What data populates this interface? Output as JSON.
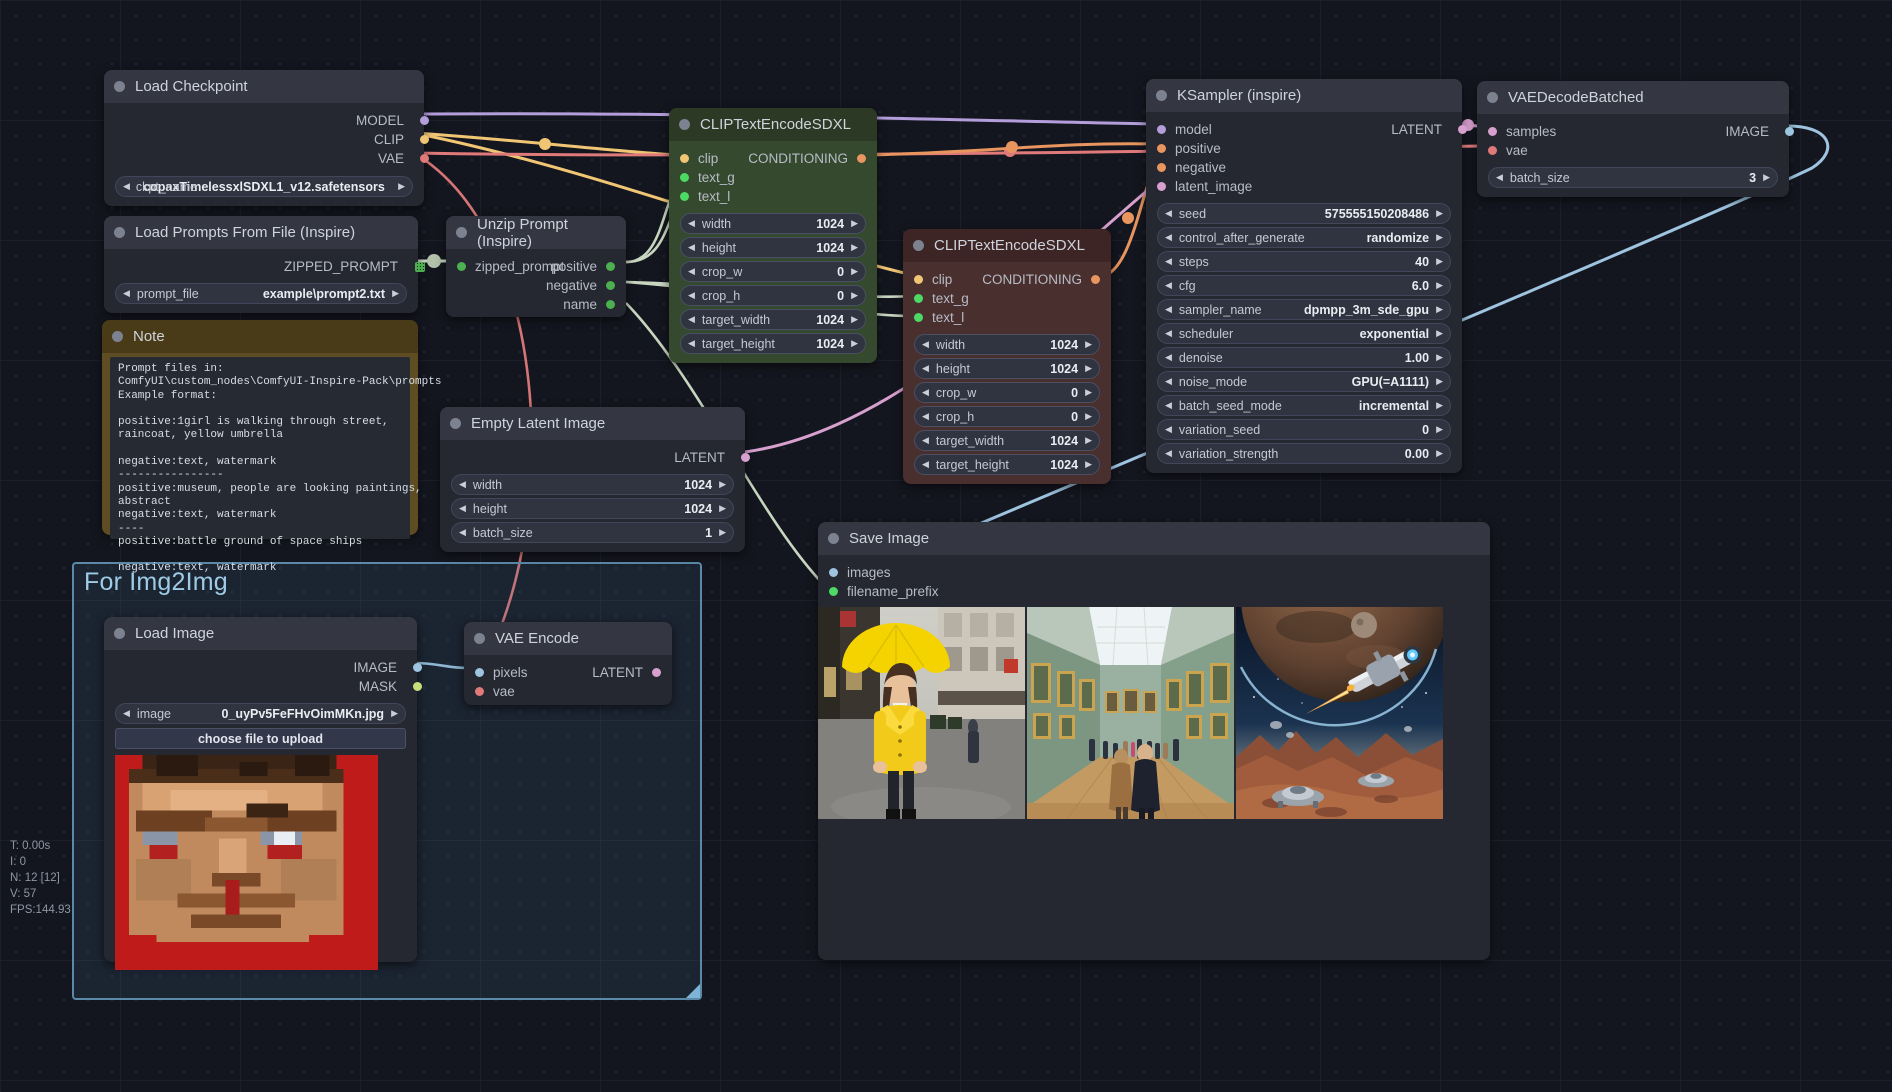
{
  "app": {
    "name": "ComfyUI graph canvas"
  },
  "stats": {
    "time": "T: 0.00s",
    "iterations": "I: 0",
    "nodes": "N: 12 [12]",
    "version": "V: 57",
    "fps": "FPS:144.93"
  },
  "group": {
    "title": "For Img2Img"
  },
  "colors": {
    "node_bg": "#252831",
    "node_header": "#343741",
    "note_bg": "#5e4d23",
    "positive_node": "#35492f",
    "negative_node": "#4a2f2f",
    "group_border": "#5a8aa8",
    "wire_model": "#b39ddb",
    "wire_clip": "#f0c674",
    "wire_vae": "#e07a7a",
    "wire_conditioning": "#e8955f",
    "wire_latent": "#d8a0cf",
    "wire_image": "#9ec4e0",
    "wire_string": "#c8d6c0"
  },
  "nodes": [
    {
      "id": "load-checkpoint",
      "title": "Load Checkpoint",
      "outputs": [
        {
          "label": "MODEL",
          "color": "#b39ddb"
        },
        {
          "label": "CLIP",
          "color": "#f0c674"
        },
        {
          "label": "VAE",
          "color": "#e07a7a"
        }
      ],
      "widgets": [
        {
          "name": "ckpt_name",
          "value": "copaxTimelessxlSDXL1_v12.safetensors",
          "overlap": true
        }
      ]
    },
    {
      "id": "load-prompts-from-file",
      "title": "Load Prompts From File (Inspire)",
      "outputs": [
        {
          "label": "ZIPPED_PROMPT",
          "color": "#4caf50",
          "shape": "grid"
        }
      ],
      "widgets": [
        {
          "name": "prompt_file",
          "value": "example\\prompt2.txt"
        }
      ]
    },
    {
      "id": "unzip-prompt",
      "title": "Unzip Prompt (Inspire)",
      "inputs": [
        {
          "label": "zipped_prompt",
          "color": "#4caf50"
        }
      ],
      "outputs": [
        {
          "label": "positive",
          "color": "#4caf50"
        },
        {
          "label": "negative",
          "color": "#4caf50"
        },
        {
          "label": "name",
          "color": "#4caf50"
        }
      ]
    },
    {
      "id": "note",
      "title": "Note",
      "text": "Prompt files in:\nComfyUI\\custom_nodes\\ComfyUI-Inspire-Pack\\prompts\nExample format:\n\npositive:1girl is walking through street,\nraincoat, yellow umbrella\n\nnegative:text, watermark\n----------------\npositive:museum, people are looking paintings,\nabstract\nnegative:text, watermark\n----\npositive:battle ground of space ships\n\nnegative:text, watermark"
    },
    {
      "id": "clip-text-encode-sdxl-positive",
      "title": "CLIPTextEncodeSDXL",
      "inputs": [
        {
          "label": "clip",
          "color": "#f0c674"
        },
        {
          "label": "text_g",
          "color": "#4cd964"
        },
        {
          "label": "text_l",
          "color": "#4cd964"
        }
      ],
      "outputs": [
        {
          "label": "CONDITIONING",
          "color": "#e8955f"
        }
      ],
      "widgets": [
        {
          "name": "width",
          "value": "1024"
        },
        {
          "name": "height",
          "value": "1024"
        },
        {
          "name": "crop_w",
          "value": "0"
        },
        {
          "name": "crop_h",
          "value": "0"
        },
        {
          "name": "target_width",
          "value": "1024"
        },
        {
          "name": "target_height",
          "value": "1024"
        }
      ]
    },
    {
      "id": "clip-text-encode-sdxl-negative",
      "title": "CLIPTextEncodeSDXL",
      "inputs": [
        {
          "label": "clip",
          "color": "#f0c674"
        },
        {
          "label": "text_g",
          "color": "#4cd964"
        },
        {
          "label": "text_l",
          "color": "#4cd964"
        }
      ],
      "outputs": [
        {
          "label": "CONDITIONING",
          "color": "#e8955f"
        }
      ],
      "widgets": [
        {
          "name": "width",
          "value": "1024"
        },
        {
          "name": "height",
          "value": "1024"
        },
        {
          "name": "crop_w",
          "value": "0"
        },
        {
          "name": "crop_h",
          "value": "0"
        },
        {
          "name": "target_width",
          "value": "1024"
        },
        {
          "name": "target_height",
          "value": "1024"
        }
      ]
    },
    {
      "id": "empty-latent-image",
      "title": "Empty Latent Image",
      "outputs": [
        {
          "label": "LATENT",
          "color": "#d8a0cf"
        }
      ],
      "widgets": [
        {
          "name": "width",
          "value": "1024"
        },
        {
          "name": "height",
          "value": "1024"
        },
        {
          "name": "batch_size",
          "value": "1"
        }
      ]
    },
    {
      "id": "ksampler-inspire",
      "title": "KSampler (inspire)",
      "inputs": [
        {
          "label": "model",
          "color": "#b39ddb"
        },
        {
          "label": "positive",
          "color": "#e8955f"
        },
        {
          "label": "negative",
          "color": "#e8955f"
        },
        {
          "label": "latent_image",
          "color": "#d8a0cf"
        }
      ],
      "outputs": [
        {
          "label": "LATENT",
          "color": "#d8a0cf"
        }
      ],
      "widgets": [
        {
          "name": "seed",
          "value": "575555150208486"
        },
        {
          "name": "control_after_generate",
          "value": "randomize"
        },
        {
          "name": "steps",
          "value": "40"
        },
        {
          "name": "cfg",
          "value": "6.0"
        },
        {
          "name": "sampler_name",
          "value": "dpmpp_3m_sde_gpu"
        },
        {
          "name": "scheduler",
          "value": "exponential"
        },
        {
          "name": "denoise",
          "value": "1.00"
        },
        {
          "name": "noise_mode",
          "value": "GPU(=A1111)"
        },
        {
          "name": "batch_seed_mode",
          "value": "incremental"
        },
        {
          "name": "variation_seed",
          "value": "0"
        },
        {
          "name": "variation_strength",
          "value": "0.00"
        }
      ]
    },
    {
      "id": "vae-decode-batched",
      "title": "VAEDecodeBatched",
      "inputs": [
        {
          "label": "samples",
          "color": "#d8a0cf"
        },
        {
          "label": "vae",
          "color": "#e07a7a"
        }
      ],
      "outputs": [
        {
          "label": "IMAGE",
          "color": "#9ec4e0"
        }
      ],
      "widgets": [
        {
          "name": "batch_size",
          "value": "3"
        }
      ]
    },
    {
      "id": "save-image",
      "title": "Save Image",
      "inputs": [
        {
          "label": "images",
          "color": "#9ec4e0"
        },
        {
          "label": "filename_prefix",
          "color": "#4cd964"
        }
      ],
      "previews": [
        {
          "alt": "girl in yellow raincoat with umbrella on wet street"
        },
        {
          "alt": "museum interior with people looking at paintings"
        },
        {
          "alt": "spaceship battle over red planet surface"
        }
      ]
    },
    {
      "id": "load-image",
      "title": "Load Image",
      "outputs": [
        {
          "label": "IMAGE",
          "color": "#9ec4e0"
        },
        {
          "label": "MASK",
          "color": "#c5e07a"
        }
      ],
      "widgets": [
        {
          "name": "image",
          "value": "0_uyPv5FeFHvOimMKn.jpg"
        }
      ],
      "upload_button": "choose file to upload",
      "preview_alt": "pixelated face on red background"
    },
    {
      "id": "vae-encode",
      "title": "VAE Encode",
      "inputs": [
        {
          "label": "pixels",
          "color": "#9ec4e0"
        },
        {
          "label": "vae",
          "color": "#e07a7a"
        }
      ],
      "outputs": [
        {
          "label": "LATENT",
          "color": "#d8a0cf"
        }
      ]
    }
  ]
}
